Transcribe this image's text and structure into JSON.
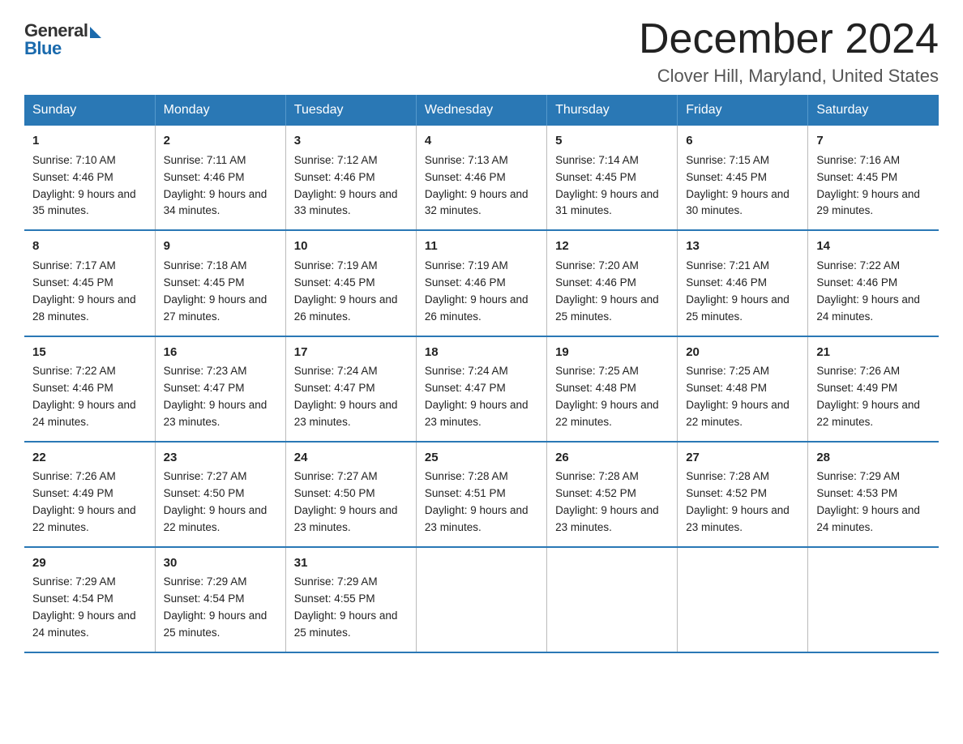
{
  "logo": {
    "general": "General",
    "blue": "Blue"
  },
  "title": "December 2024",
  "subtitle": "Clover Hill, Maryland, United States",
  "headers": [
    "Sunday",
    "Monday",
    "Tuesday",
    "Wednesday",
    "Thursday",
    "Friday",
    "Saturday"
  ],
  "weeks": [
    [
      {
        "day": "1",
        "sunrise": "7:10 AM",
        "sunset": "4:46 PM",
        "daylight": "9 hours and 35 minutes."
      },
      {
        "day": "2",
        "sunrise": "7:11 AM",
        "sunset": "4:46 PM",
        "daylight": "9 hours and 34 minutes."
      },
      {
        "day": "3",
        "sunrise": "7:12 AM",
        "sunset": "4:46 PM",
        "daylight": "9 hours and 33 minutes."
      },
      {
        "day": "4",
        "sunrise": "7:13 AM",
        "sunset": "4:46 PM",
        "daylight": "9 hours and 32 minutes."
      },
      {
        "day": "5",
        "sunrise": "7:14 AM",
        "sunset": "4:45 PM",
        "daylight": "9 hours and 31 minutes."
      },
      {
        "day": "6",
        "sunrise": "7:15 AM",
        "sunset": "4:45 PM",
        "daylight": "9 hours and 30 minutes."
      },
      {
        "day": "7",
        "sunrise": "7:16 AM",
        "sunset": "4:45 PM",
        "daylight": "9 hours and 29 minutes."
      }
    ],
    [
      {
        "day": "8",
        "sunrise": "7:17 AM",
        "sunset": "4:45 PM",
        "daylight": "9 hours and 28 minutes."
      },
      {
        "day": "9",
        "sunrise": "7:18 AM",
        "sunset": "4:45 PM",
        "daylight": "9 hours and 27 minutes."
      },
      {
        "day": "10",
        "sunrise": "7:19 AM",
        "sunset": "4:45 PM",
        "daylight": "9 hours and 26 minutes."
      },
      {
        "day": "11",
        "sunrise": "7:19 AM",
        "sunset": "4:46 PM",
        "daylight": "9 hours and 26 minutes."
      },
      {
        "day": "12",
        "sunrise": "7:20 AM",
        "sunset": "4:46 PM",
        "daylight": "9 hours and 25 minutes."
      },
      {
        "day": "13",
        "sunrise": "7:21 AM",
        "sunset": "4:46 PM",
        "daylight": "9 hours and 25 minutes."
      },
      {
        "day": "14",
        "sunrise": "7:22 AM",
        "sunset": "4:46 PM",
        "daylight": "9 hours and 24 minutes."
      }
    ],
    [
      {
        "day": "15",
        "sunrise": "7:22 AM",
        "sunset": "4:46 PM",
        "daylight": "9 hours and 24 minutes."
      },
      {
        "day": "16",
        "sunrise": "7:23 AM",
        "sunset": "4:47 PM",
        "daylight": "9 hours and 23 minutes."
      },
      {
        "day": "17",
        "sunrise": "7:24 AM",
        "sunset": "4:47 PM",
        "daylight": "9 hours and 23 minutes."
      },
      {
        "day": "18",
        "sunrise": "7:24 AM",
        "sunset": "4:47 PM",
        "daylight": "9 hours and 23 minutes."
      },
      {
        "day": "19",
        "sunrise": "7:25 AM",
        "sunset": "4:48 PM",
        "daylight": "9 hours and 22 minutes."
      },
      {
        "day": "20",
        "sunrise": "7:25 AM",
        "sunset": "4:48 PM",
        "daylight": "9 hours and 22 minutes."
      },
      {
        "day": "21",
        "sunrise": "7:26 AM",
        "sunset": "4:49 PM",
        "daylight": "9 hours and 22 minutes."
      }
    ],
    [
      {
        "day": "22",
        "sunrise": "7:26 AM",
        "sunset": "4:49 PM",
        "daylight": "9 hours and 22 minutes."
      },
      {
        "day": "23",
        "sunrise": "7:27 AM",
        "sunset": "4:50 PM",
        "daylight": "9 hours and 22 minutes."
      },
      {
        "day": "24",
        "sunrise": "7:27 AM",
        "sunset": "4:50 PM",
        "daylight": "9 hours and 23 minutes."
      },
      {
        "day": "25",
        "sunrise": "7:28 AM",
        "sunset": "4:51 PM",
        "daylight": "9 hours and 23 minutes."
      },
      {
        "day": "26",
        "sunrise": "7:28 AM",
        "sunset": "4:52 PM",
        "daylight": "9 hours and 23 minutes."
      },
      {
        "day": "27",
        "sunrise": "7:28 AM",
        "sunset": "4:52 PM",
        "daylight": "9 hours and 23 minutes."
      },
      {
        "day": "28",
        "sunrise": "7:29 AM",
        "sunset": "4:53 PM",
        "daylight": "9 hours and 24 minutes."
      }
    ],
    [
      {
        "day": "29",
        "sunrise": "7:29 AM",
        "sunset": "4:54 PM",
        "daylight": "9 hours and 24 minutes."
      },
      {
        "day": "30",
        "sunrise": "7:29 AM",
        "sunset": "4:54 PM",
        "daylight": "9 hours and 25 minutes."
      },
      {
        "day": "31",
        "sunrise": "7:29 AM",
        "sunset": "4:55 PM",
        "daylight": "9 hours and 25 minutes."
      },
      null,
      null,
      null,
      null
    ]
  ]
}
